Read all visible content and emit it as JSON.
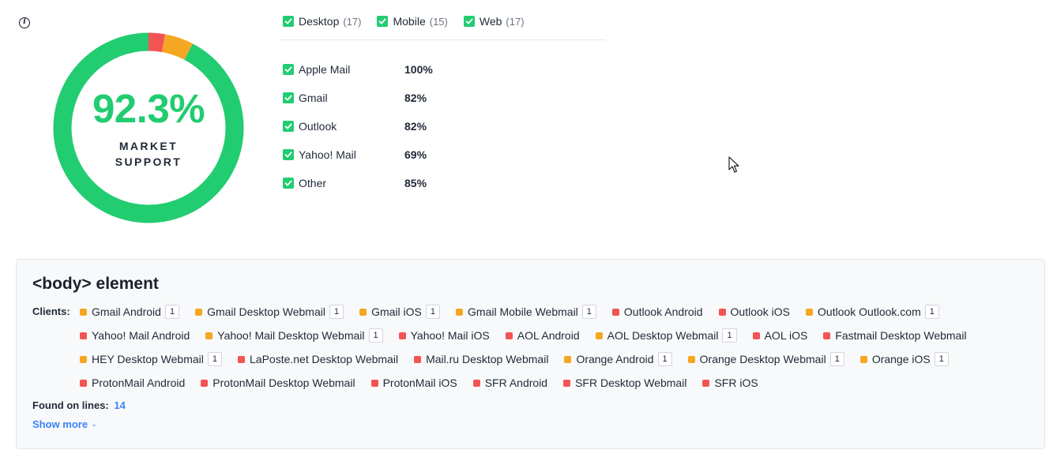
{
  "summary": {
    "value": "92.3%",
    "caption": "MARKET SUPPORT",
    "breakdown": {
      "supported": 0.923,
      "unsupported": 0.028,
      "partial": 0.049
    },
    "colors": {
      "supported": "#22cc70",
      "unsupported": "#f25454",
      "partial": "#f5a623"
    }
  },
  "info": {
    "icon": "info-icon",
    "glyph": "i"
  },
  "filters": [
    {
      "label": "Desktop",
      "count": "(17)",
      "checked": true
    },
    {
      "label": "Mobile",
      "count": "(15)",
      "checked": true
    },
    {
      "label": "Web",
      "count": "(17)",
      "checked": true
    }
  ],
  "clients": [
    {
      "name": "Apple Mail",
      "percent": "100%"
    },
    {
      "name": "Gmail",
      "percent": "82%"
    },
    {
      "name": "Outlook",
      "percent": "82%"
    },
    {
      "name": "Yahoo! Mail",
      "percent": "69%"
    },
    {
      "name": "Other",
      "percent": "85%"
    }
  ],
  "panel": {
    "title": "<body> element",
    "clients_label": "Clients:",
    "status_colors": {
      "red": "#f25454",
      "orange": "#f5a623"
    },
    "tags": [
      {
        "name": "Gmail Android",
        "status": "orange",
        "badge": "1"
      },
      {
        "name": "Gmail Desktop Webmail",
        "status": "orange",
        "badge": "1"
      },
      {
        "name": "Gmail iOS",
        "status": "orange",
        "badge": "1"
      },
      {
        "name": "Gmail Mobile Webmail",
        "status": "orange",
        "badge": "1"
      },
      {
        "name": "Outlook Android",
        "status": "red",
        "badge": ""
      },
      {
        "name": "Outlook iOS",
        "status": "red",
        "badge": ""
      },
      {
        "name": "Outlook Outlook.com",
        "status": "orange",
        "badge": "1"
      },
      {
        "name": "Yahoo! Mail Android",
        "status": "red",
        "badge": ""
      },
      {
        "name": "Yahoo! Mail Desktop Webmail",
        "status": "orange",
        "badge": "1"
      },
      {
        "name": "Yahoo! Mail iOS",
        "status": "red",
        "badge": ""
      },
      {
        "name": "AOL Android",
        "status": "red",
        "badge": ""
      },
      {
        "name": "AOL Desktop Webmail",
        "status": "orange",
        "badge": "1"
      },
      {
        "name": "AOL iOS",
        "status": "red",
        "badge": ""
      },
      {
        "name": "Fastmail Desktop Webmail",
        "status": "red",
        "badge": ""
      },
      {
        "name": "HEY Desktop Webmail",
        "status": "orange",
        "badge": "1"
      },
      {
        "name": "LaPoste.net Desktop Webmail",
        "status": "red",
        "badge": ""
      },
      {
        "name": "Mail.ru Desktop Webmail",
        "status": "red",
        "badge": ""
      },
      {
        "name": "Orange Android",
        "status": "orange",
        "badge": "1"
      },
      {
        "name": "Orange Desktop Webmail",
        "status": "orange",
        "badge": "1"
      },
      {
        "name": "Orange iOS",
        "status": "orange",
        "badge": "1"
      },
      {
        "name": "ProtonMail Android",
        "status": "red",
        "badge": ""
      },
      {
        "name": "ProtonMail Desktop Webmail",
        "status": "red",
        "badge": ""
      },
      {
        "name": "ProtonMail iOS",
        "status": "red",
        "badge": ""
      },
      {
        "name": "SFR Android",
        "status": "red",
        "badge": ""
      },
      {
        "name": "SFR Desktop Webmail",
        "status": "red",
        "badge": ""
      },
      {
        "name": "SFR iOS",
        "status": "red",
        "badge": ""
      }
    ],
    "found_label": "Found on lines:",
    "found_lines": "14",
    "show_more": "Show more",
    "show_more_icon": "chevron-down-icon"
  }
}
